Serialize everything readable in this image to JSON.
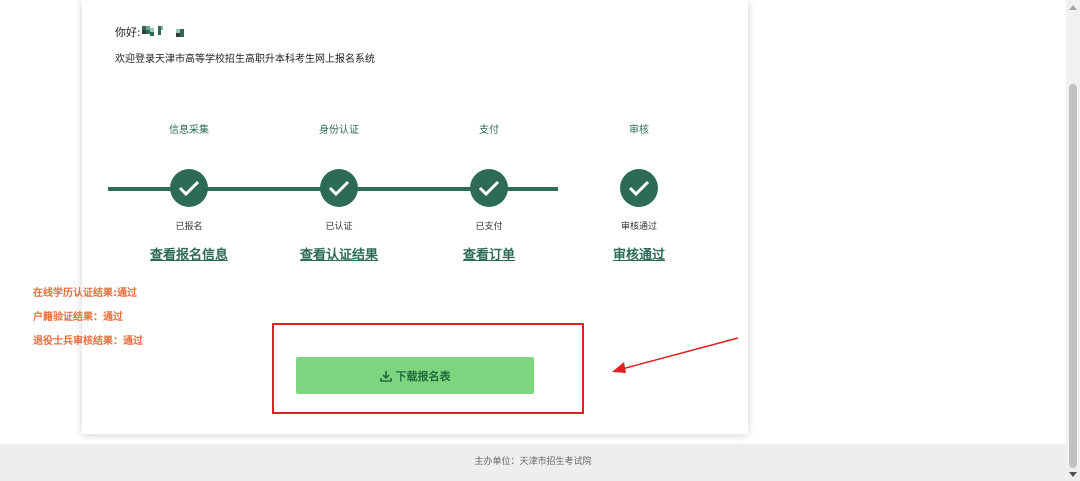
{
  "header": {
    "greeting_prefix": "你好:",
    "welcome": "欢迎登录天津市高等学校招生高职升本科考生网上报名系统"
  },
  "steps": [
    {
      "title": "信息采集",
      "status": "已报名",
      "link": "查看报名信息"
    },
    {
      "title": "身份认证",
      "status": "已认证",
      "link": "查看认证结果"
    },
    {
      "title": "支付",
      "status": "已支付",
      "link": "查看订单"
    },
    {
      "title": "审核",
      "status": "审核通过",
      "link": "审核通过"
    }
  ],
  "results": [
    "在线学历认证结果:通过",
    "户籍验证结果：通过",
    "退役士兵审核结果：通过"
  ],
  "download": {
    "label": "下载报名表",
    "icon": "download-icon"
  },
  "footer": {
    "text": "主办单位：天津市招生考试院"
  },
  "colors": {
    "primary": "#2e6b57",
    "accent_orange": "#e86f3c",
    "button_green": "#7dd67f",
    "annotation_red": "#e02020"
  }
}
